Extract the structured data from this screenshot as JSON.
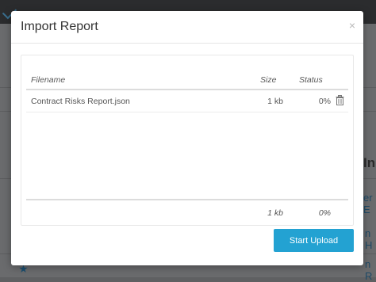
{
  "modal": {
    "title": "Import Report",
    "close_label": "×",
    "table": {
      "columns": [
        "Filename",
        "Size",
        "Status"
      ],
      "rows": [
        {
          "filename": "Contract Risks Report.json",
          "size": "1 kb",
          "status": "0%"
        }
      ],
      "footer": {
        "size": "1 kb",
        "status": "0%"
      }
    },
    "start_upload_label": "Start Upload"
  },
  "background": {
    "heading_fragment": "In",
    "link_fragments": [
      "er E",
      "n H",
      "n R"
    ]
  }
}
